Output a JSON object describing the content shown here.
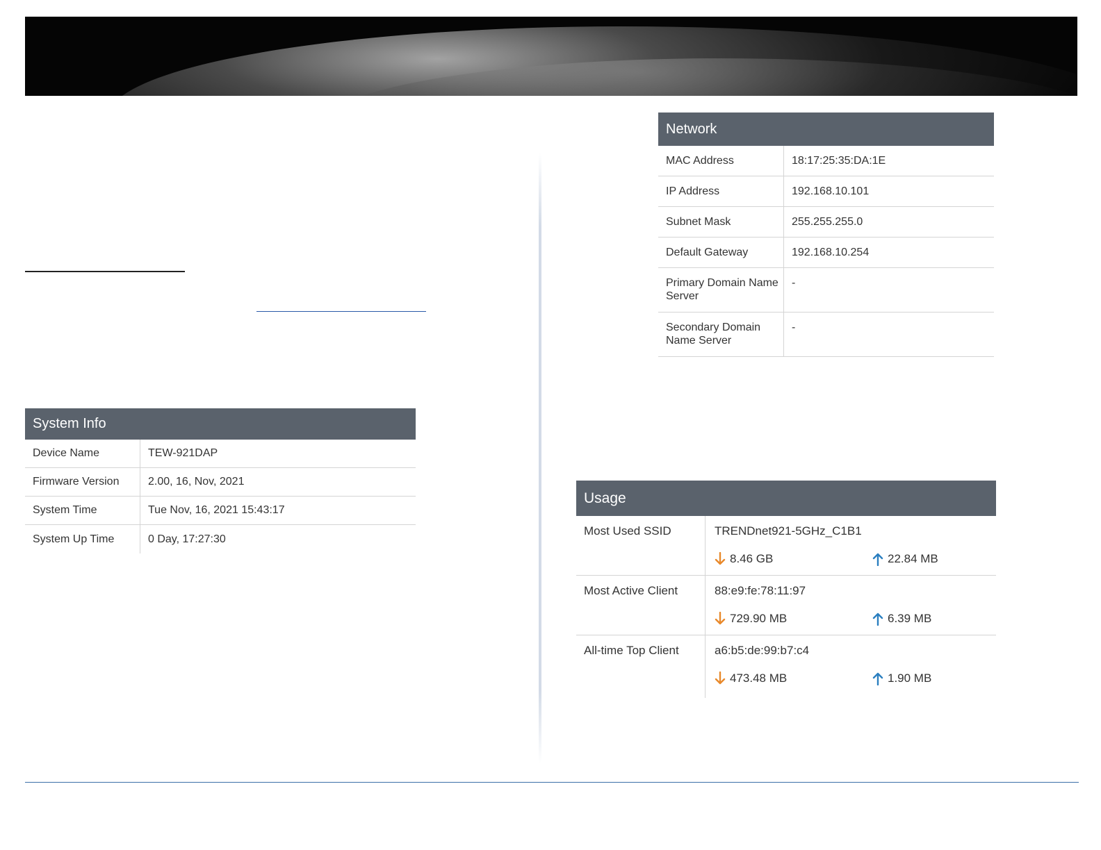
{
  "system_info": {
    "title": "System Info",
    "rows": [
      {
        "label": "Device Name",
        "value": "TEW-921DAP"
      },
      {
        "label": "Firmware Version",
        "value": "2.00, 16, Nov, 2021"
      },
      {
        "label": "System Time",
        "value": "Tue Nov, 16, 2021 15:43:17"
      },
      {
        "label": "System Up Time",
        "value": "0 Day, 17:27:30"
      }
    ]
  },
  "network": {
    "title": "Network",
    "rows": [
      {
        "label": "MAC Address",
        "value": "18:17:25:35:DA:1E"
      },
      {
        "label": "IP Address",
        "value": "192.168.10.101"
      },
      {
        "label": "Subnet Mask",
        "value": "255.255.255.0"
      },
      {
        "label": "Default Gateway",
        "value": "192.168.10.254"
      },
      {
        "label": "Primary Domain Name Server",
        "value": "-"
      },
      {
        "label": "Secondary Domain Name Server",
        "value": "-"
      }
    ]
  },
  "usage": {
    "title": "Usage",
    "rows": [
      {
        "label": "Most Used SSID",
        "client": "TRENDnet921-5GHz_C1B1",
        "download": "8.46 GB",
        "upload": "22.84 MB"
      },
      {
        "label": "Most Active Client",
        "client": "88:e9:fe:78:11:97",
        "download": "729.90 MB",
        "upload": "6.39 MB"
      },
      {
        "label": "All-time Top Client",
        "client": "a6:b5:de:99:b7:c4",
        "download": "473.48 MB",
        "upload": "1.90 MB"
      }
    ],
    "download_icon": "arrow-down-icon",
    "upload_icon": "arrow-up-icon",
    "download_color": "#e8892b",
    "upload_color": "#2b7fc0"
  },
  "colors": {
    "panel_header": "#5a626c",
    "divider": "#d3dbe7",
    "footer_line": "#3a6fa8"
  }
}
